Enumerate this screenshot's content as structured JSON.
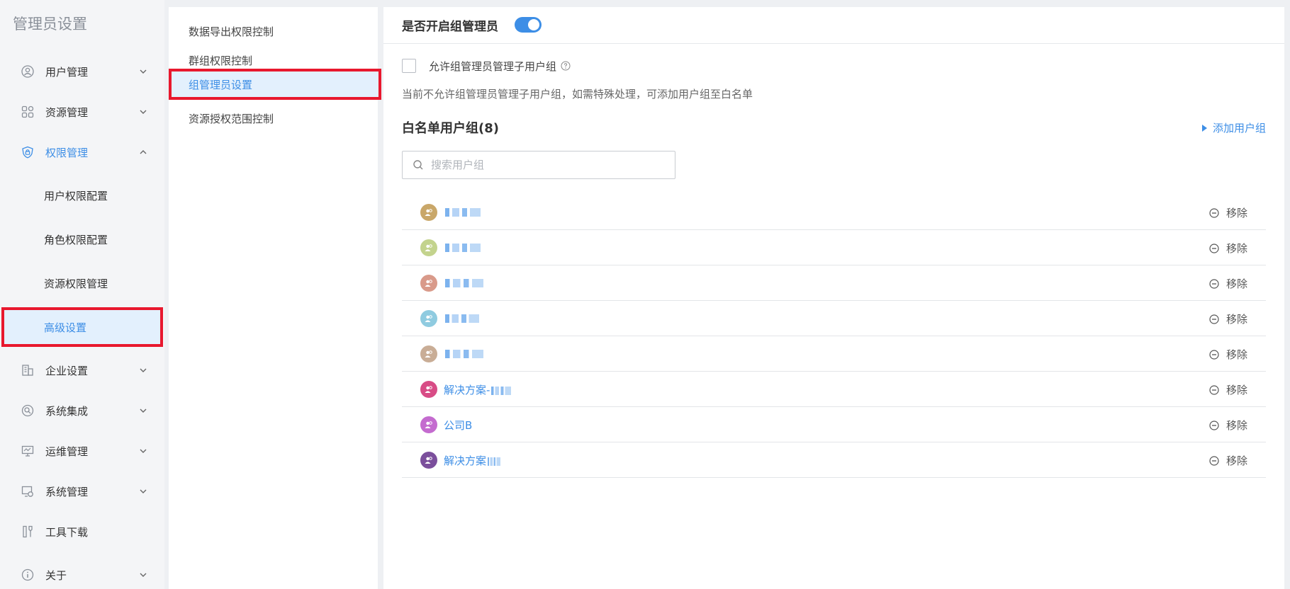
{
  "sidebar": {
    "title": "管理员设置",
    "items": [
      {
        "label": "用户管理",
        "icon": "user-icon"
      },
      {
        "label": "资源管理",
        "icon": "grid-icon"
      },
      {
        "label": "权限管理",
        "icon": "shield-icon",
        "expanded": true,
        "children": [
          {
            "label": "用户权限配置"
          },
          {
            "label": "角色权限配置"
          },
          {
            "label": "资源权限管理"
          },
          {
            "label": "高级设置",
            "active": true
          }
        ]
      },
      {
        "label": "企业设置",
        "icon": "building-icon"
      },
      {
        "label": "系统集成",
        "icon": "integration-icon"
      },
      {
        "label": "运维管理",
        "icon": "monitor-icon"
      },
      {
        "label": "系统管理",
        "icon": "system-icon"
      },
      {
        "label": "工具下载",
        "icon": "tools-icon"
      },
      {
        "label": "关于",
        "icon": "info-icon"
      }
    ]
  },
  "midnav": {
    "items": [
      {
        "label": "数据导出权限控制"
      },
      {
        "label": "群组权限控制"
      },
      {
        "label": "组管理员设置",
        "active": true
      },
      {
        "label": "资源授权范围控制"
      }
    ]
  },
  "main": {
    "title": "是否开启组管理员",
    "toggle_on": true,
    "allow_label": "允许组管理员管理子用户组",
    "info": "当前不允许组管理员管理子用户组，如需特殊处理，可添加用户组至白名单",
    "whitelist_title": "白名单用户组(8)",
    "add_group": "添加用户组",
    "search_placeholder": "搜索用户组",
    "remove_label": "移除",
    "groups": [
      {
        "name": "",
        "avatar_color": "#c9a769"
      },
      {
        "name": "",
        "avatar_color": "#c3d38d"
      },
      {
        "name": "",
        "avatar_color": "#d99a8a"
      },
      {
        "name": "",
        "avatar_color": "#8fcbe0"
      },
      {
        "name": "",
        "avatar_color": "#c9ad96"
      },
      {
        "name": "解决方案-",
        "avatar_color": "#d84c86"
      },
      {
        "name": "公司B",
        "avatar_color": "#c46bcf"
      },
      {
        "name": "解决方案",
        "avatar_color": "#7b4f9c"
      }
    ]
  },
  "colors": {
    "accent": "#3d8ee6",
    "highlight": "#e8182e"
  }
}
